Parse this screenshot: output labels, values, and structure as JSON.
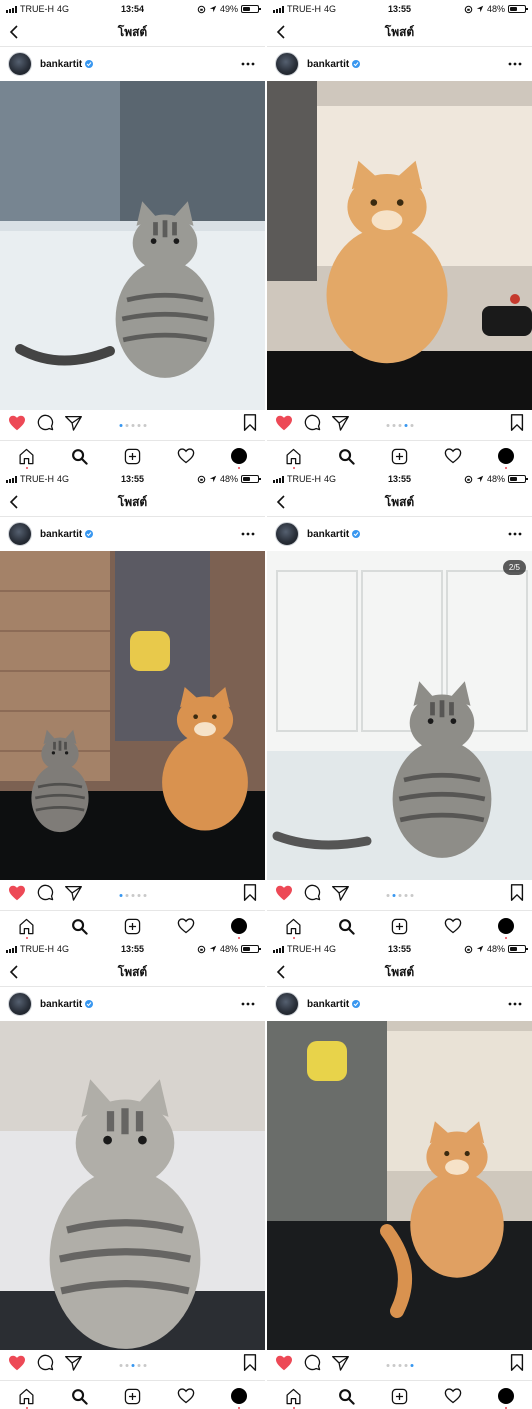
{
  "brand": {
    "heart_color": "#ed4956",
    "verified_color": "#3897f0",
    "active_dot": "#3897f0"
  },
  "panels": [
    {
      "status": {
        "carrier": "TRUE-H",
        "network": "4G",
        "time": "13:54",
        "battery": "49%",
        "battery_level": 0.49
      },
      "nav": {
        "title": "โพสต์"
      },
      "post": {
        "username": "bankartit",
        "badge": "",
        "dots_total": 5,
        "dots_active": 1,
        "scene": "grey-tabby-floor"
      }
    },
    {
      "status": {
        "carrier": "TRUE-H",
        "network": "4G",
        "time": "13:55",
        "battery": "48%",
        "battery_level": 0.48
      },
      "nav": {
        "title": "โพสต์"
      },
      "post": {
        "username": "bankartit",
        "badge": "",
        "dots_total": 5,
        "dots_active": 4,
        "scene": "orange-cat-table"
      }
    },
    {
      "status": {
        "carrier": "TRUE-H",
        "network": "4G",
        "time": "13:55",
        "battery": "48%",
        "battery_level": 0.48
      },
      "nav": {
        "title": "โพสต์"
      },
      "post": {
        "username": "bankartit",
        "badge": "",
        "dots_total": 5,
        "dots_active": 1,
        "scene": "two-cats-shelf"
      }
    },
    {
      "status": {
        "carrier": "TRUE-H",
        "network": "4G",
        "time": "13:55",
        "battery": "48%",
        "battery_level": 0.48
      },
      "nav": {
        "title": "โพสต์"
      },
      "post": {
        "username": "bankartit",
        "badge": "2/5",
        "dots_total": 5,
        "dots_active": 2,
        "scene": "grey-tabby-cabinet"
      }
    },
    {
      "status": {
        "carrier": "TRUE-H",
        "network": "4G",
        "time": "13:55",
        "battery": "48%",
        "battery_level": 0.48
      },
      "nav": {
        "title": "โพสต์"
      },
      "post": {
        "username": "bankartit",
        "badge": "",
        "dots_total": 5,
        "dots_active": 3,
        "scene": "grey-tabby-closeup"
      }
    },
    {
      "status": {
        "carrier": "TRUE-H",
        "network": "4G",
        "time": "13:55",
        "battery": "48%",
        "battery_level": 0.48
      },
      "nav": {
        "title": "โพสต์"
      },
      "post": {
        "username": "bankartit",
        "badge": "",
        "dots_total": 5,
        "dots_active": 5,
        "scene": "orange-cat-looking-back"
      }
    }
  ],
  "icons": {
    "back": "chevron-left-icon",
    "more": "more-icon",
    "like": "heart-filled-icon",
    "comment": "comment-icon",
    "share": "send-icon",
    "save": "bookmark-icon",
    "home": "home-icon",
    "search": "search-icon",
    "new_post": "add-icon",
    "activity": "heart-outline-icon",
    "profile": "profile-avatar"
  }
}
